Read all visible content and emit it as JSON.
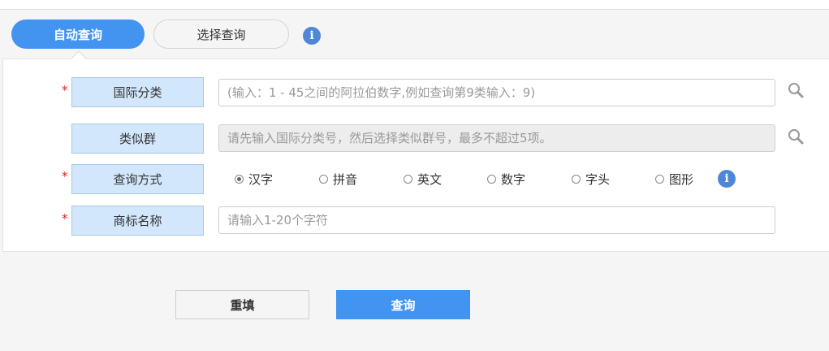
{
  "tabs": {
    "auto_label": "自动查询",
    "select_label": "选择查询"
  },
  "form": {
    "required_mark": "*",
    "intl_class": {
      "label": "国际分类",
      "placeholder": "(输入：1 - 45之间的阿拉伯数字,例如查询第9类输入：9)"
    },
    "similar_group": {
      "label": "类似群",
      "placeholder": "请先输入国际分类号，然后选择类似群号，最多不超过5项。"
    },
    "query_mode": {
      "label": "查询方式",
      "options": [
        "汉字",
        "拼音",
        "英文",
        "数字",
        "字头",
        "图形"
      ],
      "selected": "汉字"
    },
    "trademark_name": {
      "label": "商标名称",
      "placeholder": "请输入1-20个字符"
    }
  },
  "buttons": {
    "reset_label": "重填",
    "query_label": "查询"
  },
  "icons": {
    "info": "info-icon",
    "search": "search-icon"
  },
  "colors": {
    "accent": "#4393f0",
    "label_bg": "#d2e7fb",
    "required": "#e02020",
    "info_icon": "#4f87d6"
  }
}
